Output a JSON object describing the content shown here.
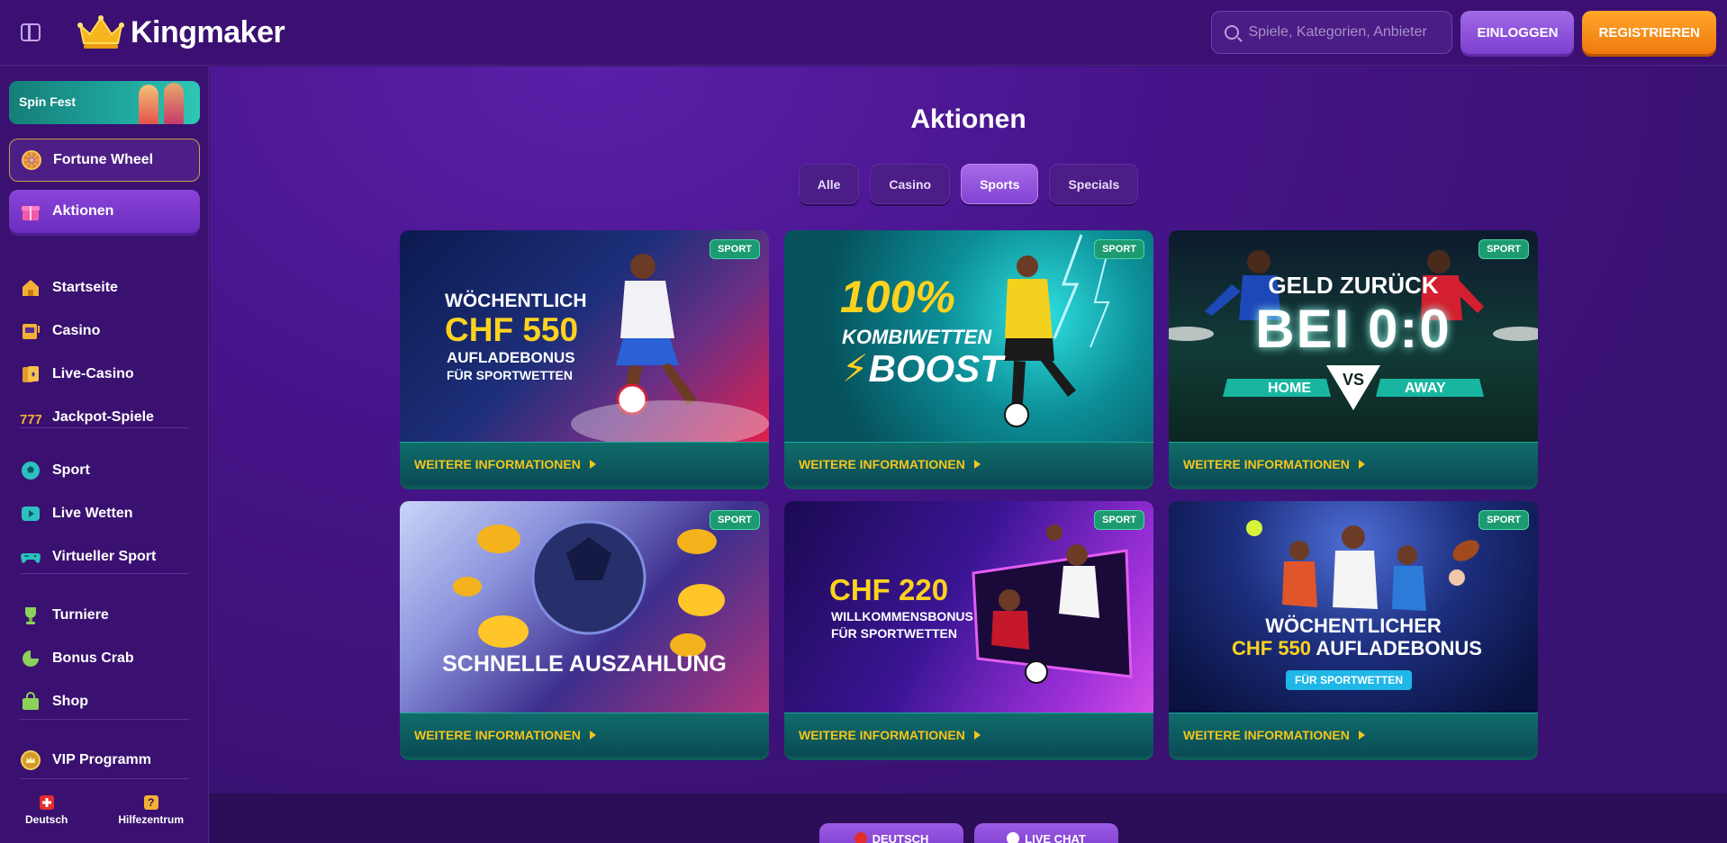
{
  "header": {
    "logo_text": "Kingmaker",
    "search_placeholder": "Spiele, Kategorien, Anbieter",
    "login_label": "EINLOGGEN",
    "register_label": "REGISTRIEREN"
  },
  "sidebar": {
    "promo_label": "Spin Fest",
    "fortune_label": "Fortune Wheel",
    "aktionen_label": "Aktionen",
    "items": [
      {
        "label": "Startseite",
        "icon": "home-icon"
      },
      {
        "label": "Casino",
        "icon": "slot-machine-icon"
      },
      {
        "label": "Live-Casino",
        "icon": "cards-icon"
      },
      {
        "label": "Jackpot-Spiele",
        "icon": "jackpot-777-icon"
      },
      {
        "label": "Sport",
        "icon": "soccer-ball-icon"
      },
      {
        "label": "Live Wetten",
        "icon": "live-play-icon"
      },
      {
        "label": "Virtueller Sport",
        "icon": "gamepad-icon"
      },
      {
        "label": "Turniere",
        "icon": "trophy-icon"
      },
      {
        "label": "Bonus Crab",
        "icon": "crab-claw-icon"
      },
      {
        "label": "Shop",
        "icon": "shopping-bag-icon"
      },
      {
        "label": "VIP Programm",
        "icon": "vip-crown-icon"
      }
    ],
    "bottom": {
      "language_label": "Deutsch",
      "help_label": "Hilfezentrum"
    }
  },
  "main": {
    "title": "Aktionen",
    "filters": [
      "Alle",
      "Casino",
      "Sports",
      "Specials"
    ],
    "active_filter": "Sports",
    "cards": [
      {
        "badge": "SPORT",
        "link": "WEITERE INFORMATIONEN",
        "lines": [
          "WÖCHENTLICH",
          "CHF 550",
          "AUFLADEBONUS",
          "FÜR SPORTWETTEN"
        ]
      },
      {
        "badge": "SPORT",
        "link": "WEITERE INFORMATIONEN",
        "lines": [
          "100%",
          "KOMBIWETTEN",
          "BOOST"
        ]
      },
      {
        "badge": "SPORT",
        "link": "WEITERE INFORMATIONEN",
        "lines": [
          "GELD ZURÜCK",
          "BEI 0:0",
          "HOME",
          "VS",
          "AWAY"
        ]
      },
      {
        "badge": "SPORT",
        "link": "WEITERE INFORMATIONEN",
        "lines": [
          "SCHNELLE AUSZAHLUNG"
        ]
      },
      {
        "badge": "SPORT",
        "link": "WEITERE INFORMATIONEN",
        "lines": [
          "CHF 220",
          "WILLKOMMENSBONUS",
          "FÜR SPORTWETTEN"
        ]
      },
      {
        "badge": "SPORT",
        "link": "WEITERE INFORMATIONEN",
        "lines": [
          "WÖCHENTLICHER",
          "CHF 550",
          "AUFLADEBONUS",
          "FÜR SPORTWETTEN"
        ]
      }
    ]
  },
  "footer": {
    "language_button": "DEUTSCH",
    "chat_button": "LIVE CHAT"
  },
  "colors": {
    "brand_purple": "#3b1072",
    "accent_orange": "#f07a0c",
    "accent_yellow": "#ffd21e",
    "badge_green": "#1c9b72"
  }
}
